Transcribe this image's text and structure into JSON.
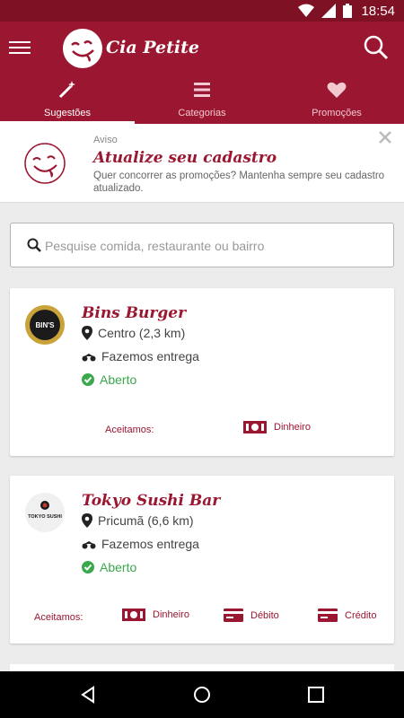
{
  "status_bar": {
    "time": "18:54"
  },
  "app": {
    "name": "Cia Petite"
  },
  "tabs": [
    {
      "label": "Sugestões",
      "icon": "magic-wand-icon",
      "active": true
    },
    {
      "label": "Categorias",
      "icon": "list-icon",
      "active": false
    },
    {
      "label": "Promoções",
      "icon": "heart-icon",
      "active": false
    }
  ],
  "notice": {
    "eyebrow": "Aviso",
    "title": "Atualize seu cadastro",
    "body": "Quer concorrer as promoções? Mantenha sempre seu cadastro atualizado."
  },
  "search": {
    "placeholder": "Pesquise comida, restaurante ou bairro"
  },
  "restaurants": [
    {
      "name": "Bins Burger",
      "location": "Centro (2,3 km)",
      "delivery": "Fazemos entrega",
      "status": "Aberto",
      "accepts_label": "Aceitamos:",
      "payments": [
        "Dinheiro"
      ]
    },
    {
      "name": "Tokyo Sushi Bar",
      "location": "Pricumã (6,6 km)",
      "delivery": "Fazemos entrega",
      "status": "Aberto",
      "accepts_label": "Aceitamos:",
      "payments": [
        "Dinheiro",
        "Débito",
        "Crédito"
      ]
    }
  ],
  "logo_text": {
    "bins": "BIN'S",
    "tokyo": "TOKYO SUSHI"
  },
  "colors": {
    "primary": "#9b1630",
    "primary_dark": "#7e1123",
    "open": "#3aa84c"
  }
}
